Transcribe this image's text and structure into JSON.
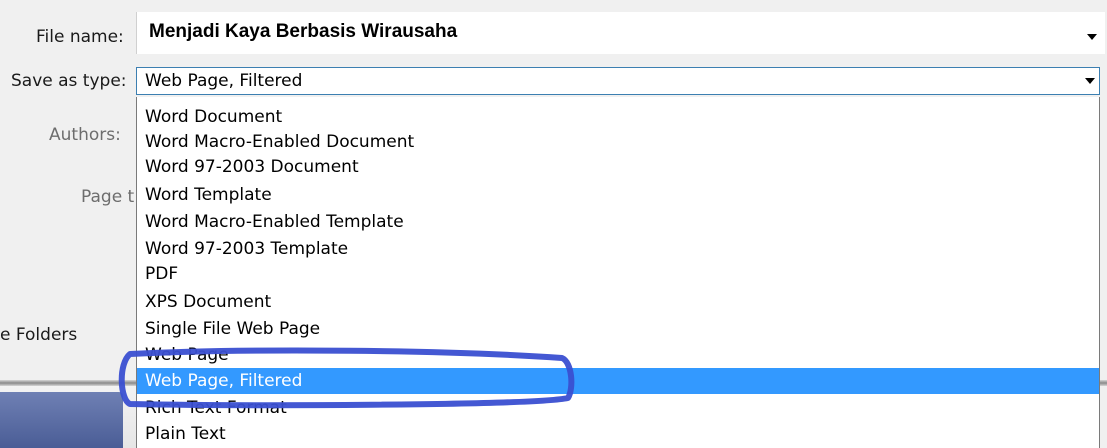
{
  "form": {
    "file_name_label": "File name:",
    "file_name_value": "Menjadi Kaya Berbasis Wirausaha",
    "save_as_type_label": "Save as type:",
    "save_as_type_value": "Web Page, Filtered",
    "authors_label": "Authors:",
    "page_title_label": "Page t",
    "hide_folders_label": "e Folders"
  },
  "dropdown": {
    "items": [
      {
        "label": "Word Document"
      },
      {
        "label": "Word Macro-Enabled Document"
      },
      {
        "label": "Word 97-2003 Document"
      },
      {
        "label": "Word Template"
      },
      {
        "label": "Word Macro-Enabled Template"
      },
      {
        "label": "Word 97-2003 Template"
      },
      {
        "label": "PDF"
      },
      {
        "label": "XPS Document"
      },
      {
        "label": "Single File Web Page"
      },
      {
        "label": "Web Page"
      },
      {
        "label": "Web Page, Filtered",
        "selected": true
      },
      {
        "label": "Rich Text Format"
      },
      {
        "label": "Plain Text"
      }
    ]
  },
  "colors": {
    "selection": "#3399ff",
    "highlight_annotation": "#3a4fd1",
    "combo_border": "#3c7fb1"
  },
  "icons": {
    "dropdown_arrow": "chevron-down-icon"
  }
}
